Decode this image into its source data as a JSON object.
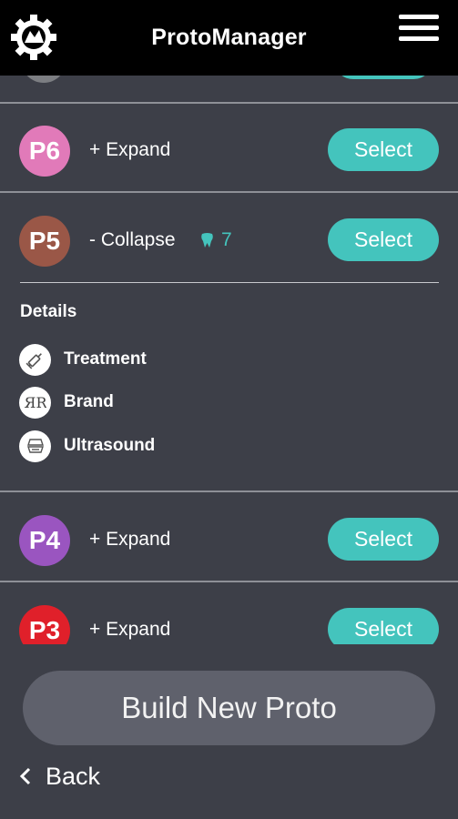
{
  "header": {
    "title": "ProtoManager",
    "logo_icon": "gear-logo-icon",
    "menu_icon": "hamburger-menu-icon"
  },
  "protos": [
    {
      "id": "P6",
      "color": "#e17ab9",
      "toggle": "+ Expand",
      "select_label": "Select"
    },
    {
      "id": "P5",
      "color": "#9a5747",
      "toggle": "- Collapse",
      "count": "7",
      "count_icon": "tooth-icon",
      "select_label": "Select",
      "details": {
        "title": "Details",
        "items": [
          {
            "label": "Treatment",
            "icon": "syringe-icon"
          },
          {
            "label": "Brand",
            "icon": "brand-icon"
          },
          {
            "label": "Ultrasound",
            "icon": "ultrasound-icon"
          }
        ]
      }
    },
    {
      "id": "P4",
      "color": "#9a55c0",
      "toggle": "+ Expand",
      "select_label": "Select"
    },
    {
      "id": "P3",
      "color": "#e0202a",
      "toggle": "+ Expand",
      "select_label": "Select"
    }
  ],
  "build_button": "Build New Proto",
  "back_label": "Back",
  "colors": {
    "accent": "#44c4bd",
    "background": "#3d3f48",
    "header": "#000000"
  }
}
